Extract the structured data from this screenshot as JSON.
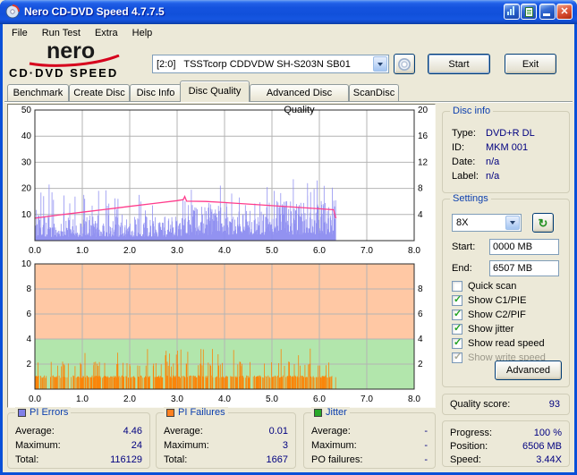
{
  "window": {
    "title": "Nero CD-DVD Speed 4.7.7.5"
  },
  "menu": {
    "items": [
      "File",
      "Run Test",
      "Extra",
      "Help"
    ]
  },
  "logo": {
    "name": "nero",
    "sub": "CD·DVD SPEED"
  },
  "drive_bar": {
    "drive": "[2:0]   TSSTcorp CDDVDW SH-S203N SB01",
    "start_button": "Start",
    "exit_button": "Exit"
  },
  "tabs": {
    "items": [
      "Benchmark",
      "Create Disc",
      "Disc Info",
      "Disc Quality",
      "Advanced Disc Quality",
      "ScanDisc"
    ],
    "active_index": 3
  },
  "disc_info": {
    "title": "Disc info",
    "rows": [
      {
        "label": "Type:",
        "value": "DVD+R DL"
      },
      {
        "label": "ID:",
        "value": "MKM 001"
      },
      {
        "label": "Date:",
        "value": "n/a"
      },
      {
        "label": "Label:",
        "value": "n/a"
      }
    ]
  },
  "settings": {
    "title": "Settings",
    "speed": "8X",
    "start_label": "Start:",
    "start_value": "0000 MB",
    "end_label": "End:",
    "end_value": "6507 MB",
    "checkboxes": [
      {
        "label": "Quick scan",
        "checked": false,
        "enabled": true
      },
      {
        "label": "Show C1/PIE",
        "checked": true,
        "enabled": true
      },
      {
        "label": "Show C2/PIF",
        "checked": true,
        "enabled": true
      },
      {
        "label": "Show jitter",
        "checked": true,
        "enabled": true
      },
      {
        "label": "Show read speed",
        "checked": true,
        "enabled": true
      },
      {
        "label": "Show write speed",
        "checked": true,
        "enabled": false
      }
    ],
    "advanced_button": "Advanced"
  },
  "quality": {
    "label": "Quality score:",
    "value": "93"
  },
  "progress": {
    "rows": [
      {
        "label": "Progress:",
        "value": "100 %"
      },
      {
        "label": "Position:",
        "value": "6506 MB"
      },
      {
        "label": "Speed:",
        "value": "3.44X"
      }
    ]
  },
  "stats": [
    {
      "title": "PI Errors",
      "color": "#8080e8",
      "rows": [
        {
          "label": "Average:",
          "value": "4.46"
        },
        {
          "label": "Maximum:",
          "value": "24"
        },
        {
          "label": "Total:",
          "value": "116129"
        }
      ]
    },
    {
      "title": "PI Failures",
      "color": "#ff8020",
      "rows": [
        {
          "label": "Average:",
          "value": "0.01"
        },
        {
          "label": "Maximum:",
          "value": "3"
        },
        {
          "label": "Total:",
          "value": "1667"
        }
      ]
    },
    {
      "title": "Jitter",
      "color": "#28a828",
      "rows": [
        {
          "label": "Average:",
          "value": "-"
        },
        {
          "label": "Maximum:",
          "value": "-"
        },
        {
          "label": "PO failures:",
          "value": "-"
        }
      ]
    }
  ],
  "chart_data": [
    {
      "type": "area",
      "name": "PI Errors (PIE) and read speed",
      "x_range": [
        0,
        8
      ],
      "x_ticks": [
        "0.0",
        "1.0",
        "2.0",
        "3.0",
        "4.0",
        "5.0",
        "6.0",
        "7.0",
        "8.0"
      ],
      "y_left": {
        "range": [
          0,
          50
        ],
        "ticks": [
          10,
          20,
          30,
          40,
          50
        ]
      },
      "y_right": {
        "range": [
          0,
          20
        ],
        "ticks": [
          4,
          8,
          12,
          16,
          20
        ]
      },
      "grid": true,
      "series": [
        {
          "name": "PIE",
          "style": "spikes",
          "gen": "pie",
          "color": "#8c8cf0",
          "seed": 5,
          "x_end": 6.35,
          "layer_break": 3.2,
          "base_before": 8.0,
          "base_after": 11.5,
          "ramp": 0.5,
          "max_before": 22,
          "max_after": 24,
          "average": 4.46,
          "maximum": 24,
          "total": 116129,
          "features": [
            [
              0.3,
              21.5
            ],
            [
              0.36,
              18.5
            ],
            [
              1.05,
              16
            ],
            [
              2.2,
              17.5
            ],
            [
              3.3,
              19.5
            ],
            [
              4.15,
              18
            ],
            [
              4.9,
              20.5
            ],
            [
              5.45,
              23.5
            ],
            [
              5.75,
              22
            ],
            [
              5.95,
              23
            ],
            [
              6.1,
              21
            ]
          ]
        },
        {
          "name": "Read speed",
          "style": "line",
          "color": "#ff3c8c",
          "points": [
            [
              0,
              8.6
            ],
            [
              0.5,
              9.8
            ],
            [
              1.0,
              10.9
            ],
            [
              1.5,
              12.0
            ],
            [
              2.0,
              13.1
            ],
            [
              2.5,
              14.2
            ],
            [
              3.0,
              15.3
            ],
            [
              3.13,
              15.7
            ],
            [
              3.16,
              16.9
            ],
            [
              3.2,
              15.1
            ],
            [
              3.6,
              15.0
            ],
            [
              4.0,
              14.6
            ],
            [
              4.5,
              14.0
            ],
            [
              5.0,
              13.4
            ],
            [
              5.5,
              12.8
            ],
            [
              6.0,
              12.2
            ],
            [
              6.3,
              11.8
            ],
            [
              6.35,
              8.6
            ]
          ]
        }
      ]
    },
    {
      "type": "bar",
      "name": "PI Failures (PIF)",
      "x_range": [
        0,
        8
      ],
      "x_ticks": [
        "0.0",
        "1.0",
        "2.0",
        "3.0",
        "4.0",
        "5.0",
        "6.0",
        "7.0",
        "8.0"
      ],
      "y_left": {
        "range": [
          0,
          10
        ],
        "ticks": [
          2,
          4,
          6,
          8,
          10
        ]
      },
      "y_right": {
        "range": [
          0,
          10
        ],
        "ticks": [
          2,
          4,
          6,
          8
        ]
      },
      "grid": true,
      "bands": [
        {
          "from": 4,
          "to": 10,
          "color": "#ffc8a4"
        },
        {
          "from": 0,
          "to": 4,
          "color": "#b2e6ac"
        }
      ],
      "series": [
        {
          "name": "PIF",
          "style": "spikes",
          "gen": "pif",
          "color": "#ff8000",
          "seed": 11,
          "x_end": 6.35,
          "density": 0.52,
          "levels": [
            1,
            2,
            3
          ],
          "average": 0.01,
          "maximum": 3,
          "total": 1667
        }
      ]
    }
  ]
}
